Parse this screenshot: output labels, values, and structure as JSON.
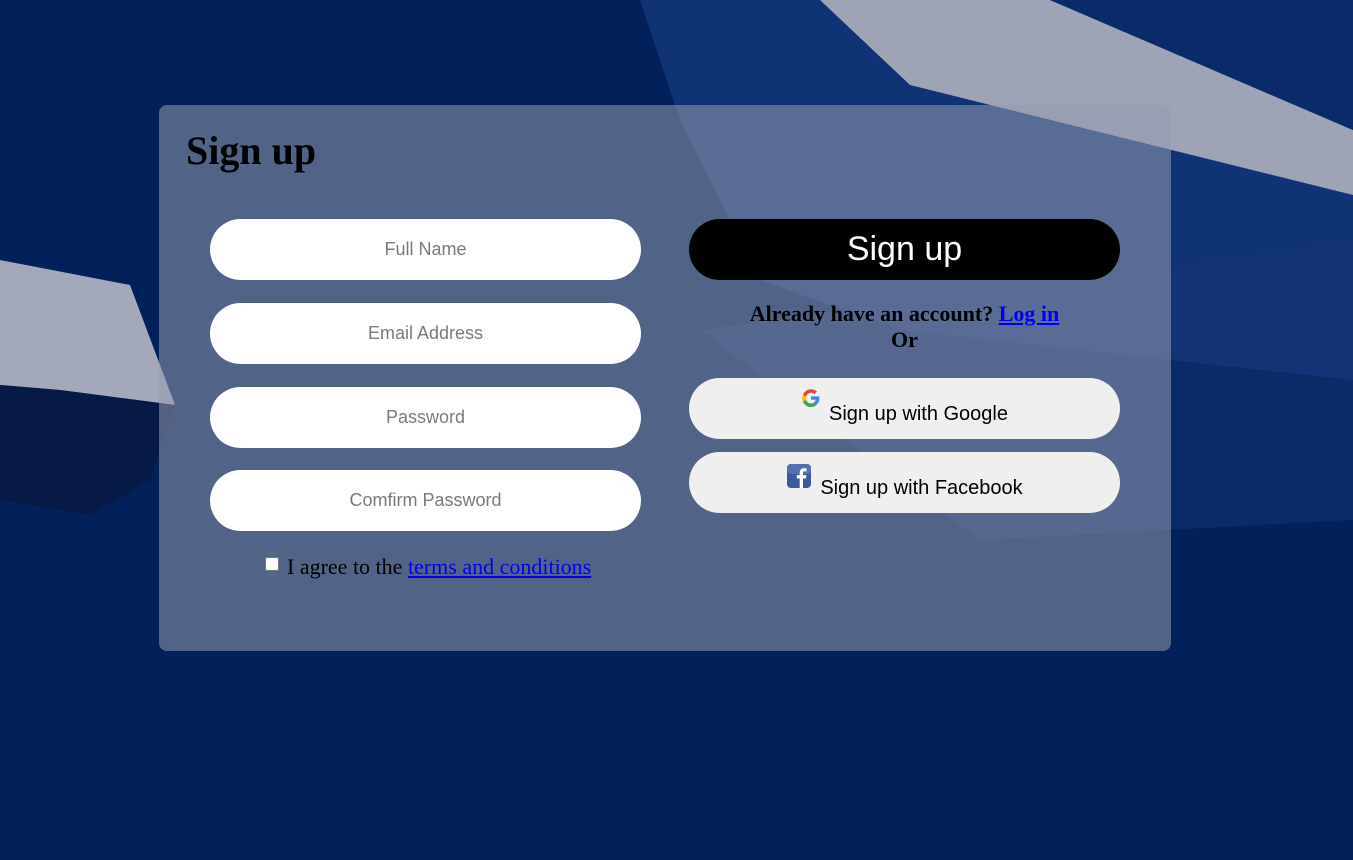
{
  "form": {
    "title": "Sign up",
    "fields": {
      "full_name": {
        "placeholder": "Full Name",
        "value": ""
      },
      "email": {
        "placeholder": "Email Address",
        "value": ""
      },
      "password": {
        "placeholder": "Password",
        "value": ""
      },
      "confirm_password": {
        "placeholder": "Comfirm Password",
        "value": ""
      }
    },
    "agree": {
      "checked": false,
      "prefix": "I agree to the",
      "link": "terms and conditions"
    }
  },
  "actions": {
    "signup_label": "Sign up",
    "already_text": "Already have an account?",
    "login_link": "Log in",
    "or_text": "Or",
    "google_label": "Sign up with Google",
    "facebook_label": "Sign up with Facebook"
  },
  "icons": {
    "google": "google-icon",
    "facebook": "facebook-icon"
  },
  "colors": {
    "background": "#02215a",
    "primary_button": "#000000",
    "link": "#0000ee",
    "social_button": "#efefef"
  }
}
